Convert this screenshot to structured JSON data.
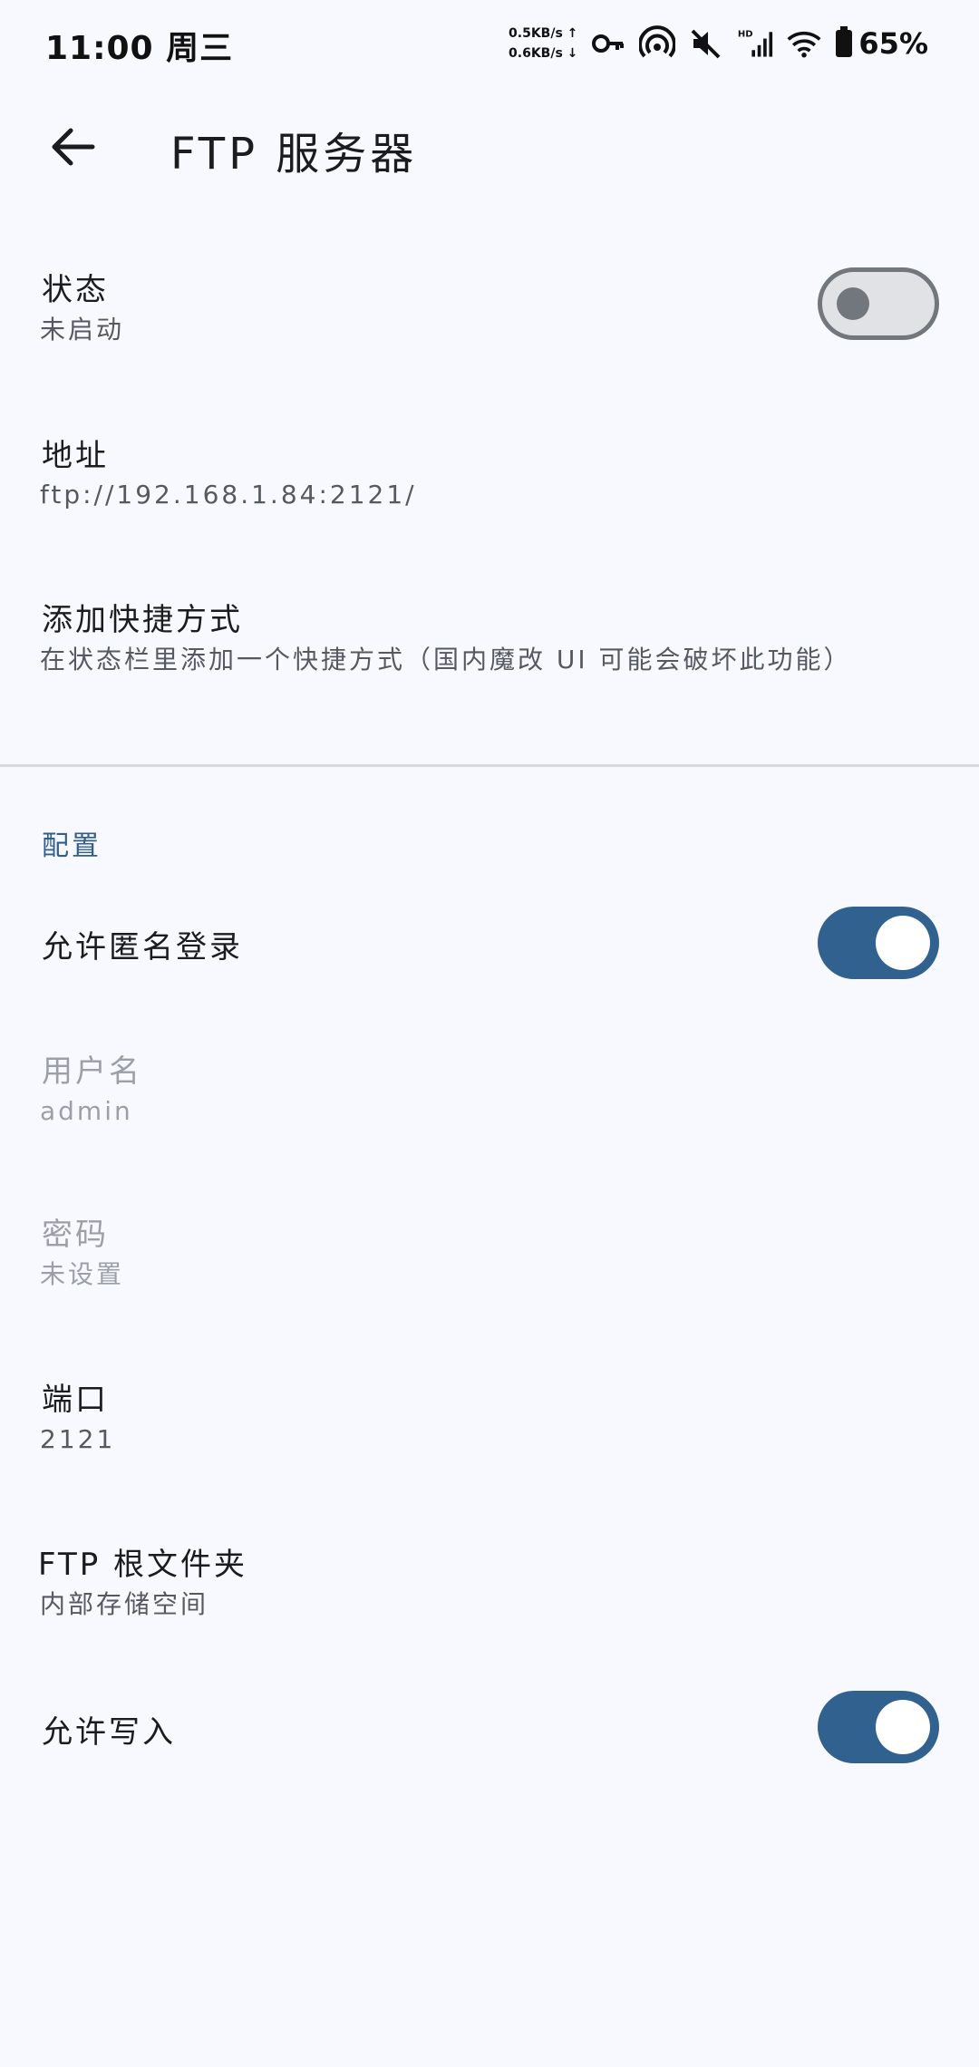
{
  "status_bar": {
    "time": "11:00 周三",
    "upload_speed": "0.5KB/s ↑",
    "download_speed": "0.6KB/s ↓",
    "battery": "65%",
    "icons": [
      "key-icon",
      "hotspot-icon",
      "mute-icon",
      "hd-signal-icon",
      "wifi-icon",
      "battery-icon"
    ]
  },
  "app_bar": {
    "title": "FTP 服务器",
    "back_icon": "arrow-back-icon"
  },
  "general": [
    {
      "title": "状态",
      "summary": "未启动",
      "switch": "off"
    },
    {
      "title": "地址",
      "summary": "ftp://192.168.1.84:2121/"
    },
    {
      "title": "添加快捷方式",
      "summary": "在状态栏里添加一个快捷方式（国内魔改 UI 可能会破坏此功能）"
    }
  ],
  "config": {
    "header": "配置",
    "items": [
      {
        "title": "允许匿名登录",
        "switch": "on"
      },
      {
        "title": "用户名",
        "summary": "admin",
        "enabled": false
      },
      {
        "title": "密码",
        "summary": "未设置",
        "enabled": false
      },
      {
        "title": "端口",
        "summary": "2121"
      },
      {
        "title": "FTP 根文件夹",
        "summary": "内部存储空间"
      },
      {
        "title": "允许写入",
        "switch": "on"
      }
    ]
  },
  "colors": {
    "accent": "#30618f",
    "background": "#f8f9ff",
    "switch_off": "#72777d"
  }
}
